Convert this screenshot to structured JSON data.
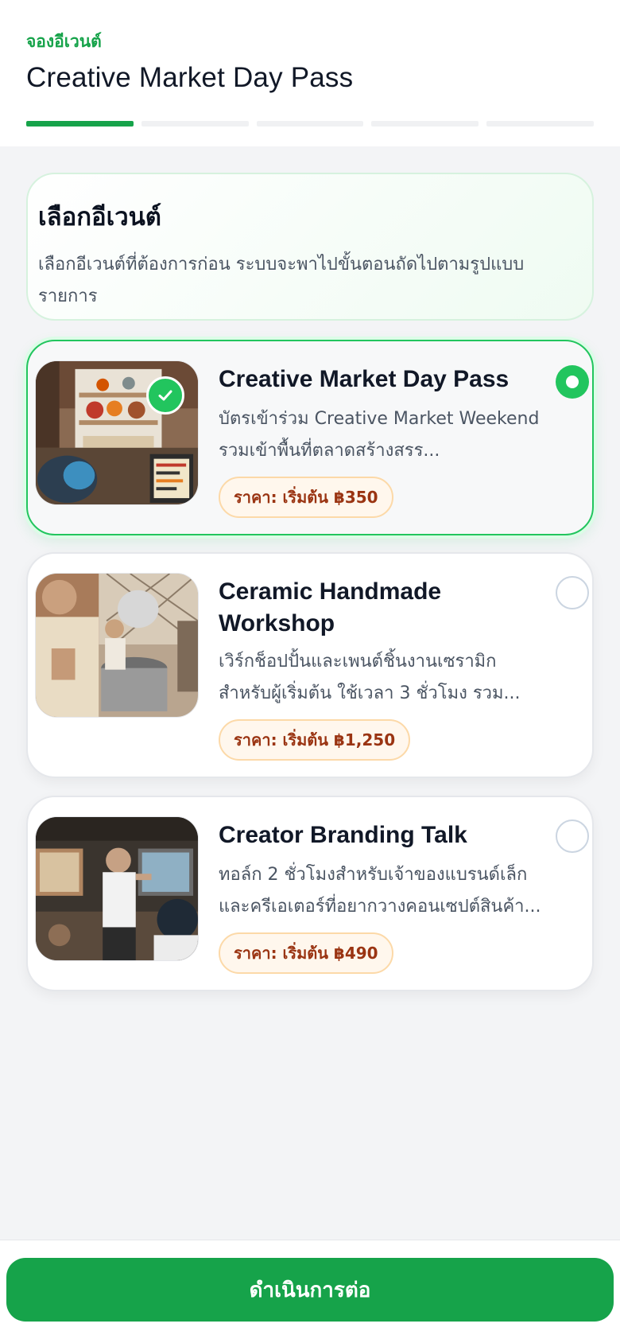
{
  "header": {
    "breadcrumb": "จองอีเวนต์",
    "title": "Creative Market Day Pass",
    "steps_total": 5,
    "current_step": 1
  },
  "intro": {
    "title": "เลือกอีเวนต์",
    "description": "เลือกอีเวนต์ที่ต้องการก่อน ระบบจะพาไปขั้นตอนถัดไปตามรูปแบบรายการ"
  },
  "events": [
    {
      "title": "Creative Market Day Pass",
      "description": "บัตรเข้าร่วม Creative Market Weekend รวมเข้าพื้นที่ตลาดสร้างสรร...",
      "price": "ราคา: เริ่มต้น ฿350",
      "selected": true,
      "image": "market-stall-photo"
    },
    {
      "title": "Ceramic Handmade Workshop",
      "description": "เวิร์กช็อปปั้นและเพนต์ชิ้นงานเซรามิก สำหรับผู้เริ่มต้น ใช้เวลา 3 ชั่วโมง รวม...",
      "price": "ราคา: เริ่มต้น ฿1,250",
      "selected": false,
      "image": "ceramic-workshop-photo"
    },
    {
      "title": "Creator Branding Talk",
      "description": "ทอล์ก 2 ชั่วโมงสำหรับเจ้าของแบรนด์เล็ก และครีเอเตอร์ที่อยากวางคอนเซปต์สินค้า...",
      "price": "ราคา: เริ่มต้น ฿490",
      "selected": false,
      "image": "branding-talk-photo"
    }
  ],
  "footer": {
    "continue_label": "ดำเนินการต่อ"
  },
  "colors": {
    "accent": "#16a34a",
    "selected_border": "#22c55e",
    "price_text": "#9a3412",
    "price_bg": "#fff7ed"
  }
}
